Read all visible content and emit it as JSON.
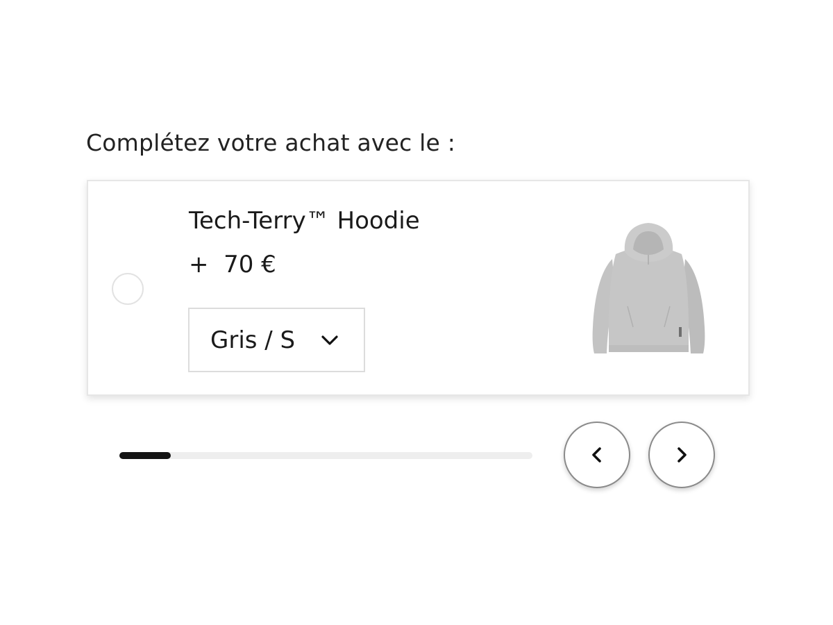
{
  "upsell": {
    "heading": "Complétez votre achat avec le :"
  },
  "product": {
    "name": "Tech-Terry™ Hoodie",
    "price": "+  70 €",
    "selected": false,
    "variant": "Gris / S",
    "image_icon": "grey-hoodie-image"
  },
  "carousel": {
    "progress": 0.125,
    "prev_icon": "chevron-left-icon",
    "next_icon": "chevron-right-icon"
  },
  "colors": {
    "text": "#1a1a1a",
    "border": "#e6e6e6",
    "progress_track": "#eeeeee",
    "progress_fill": "#141414",
    "hoodie": "#c4c4c4"
  }
}
